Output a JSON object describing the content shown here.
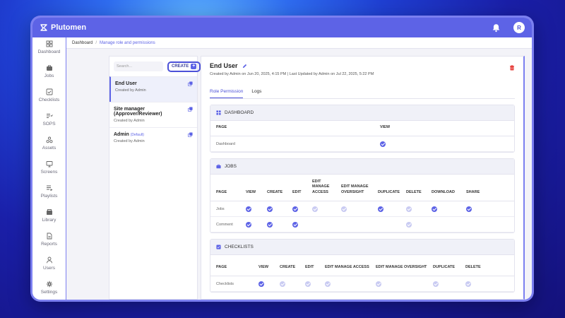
{
  "app": {
    "name": "Plutomen",
    "user_initial": "R"
  },
  "sidebar": {
    "items": [
      {
        "label": "Dashboard",
        "icon": "grid-icon"
      },
      {
        "label": "Jobs",
        "icon": "briefcase-icon"
      },
      {
        "label": "Checklists",
        "icon": "checklist-icon"
      },
      {
        "label": "SOPS",
        "icon": "list-icon"
      },
      {
        "label": "Assets",
        "icon": "assets-icon"
      },
      {
        "label": "Screens",
        "icon": "monitor-icon"
      },
      {
        "label": "Playlists",
        "icon": "playlist-icon"
      },
      {
        "label": "Library",
        "icon": "library-icon"
      },
      {
        "label": "Reports",
        "icon": "report-icon"
      },
      {
        "label": "Users",
        "icon": "user-icon"
      },
      {
        "label": "Settings",
        "icon": "gear-icon"
      }
    ]
  },
  "breadcrumb": {
    "root": "Dashboard",
    "current": "Manage role and permissions"
  },
  "roles_panel": {
    "search_placeholder": "Search...",
    "create_label": "CREATE",
    "roles": [
      {
        "name": "End User",
        "tag": "",
        "created_by": "Created by Admin",
        "active": true
      },
      {
        "name": "Site manager (Approver/Reviewer)",
        "tag": "",
        "created_by": "Created by Admin",
        "active": false
      },
      {
        "name": "Admin",
        "tag": "(Default)",
        "created_by": "Created by Admin",
        "active": false
      }
    ]
  },
  "detail": {
    "title": "End User",
    "meta": "Created by Admin on Jun 20, 2025, 4:15 PM | Last Updated by Admin on Jul 22, 2025, 5:22 PM",
    "tabs": [
      {
        "label": "Role Permission",
        "active": true
      },
      {
        "label": "Logs",
        "active": false
      }
    ],
    "sections": {
      "dashboard": {
        "title": "DASHBOARD",
        "headers": [
          "PAGE",
          "VIEW"
        ],
        "rows": [
          {
            "page": "Dashboard",
            "cells": [
              "on"
            ]
          }
        ]
      },
      "jobs": {
        "title": "JOBS",
        "headers": [
          "PAGE",
          "VIEW",
          "CREATE",
          "EDIT",
          "EDIT MANAGE ACCESS",
          "EDIT MANAGE OVERSIGHT",
          "DUPLICATE",
          "DELETE",
          "DOWNLOAD",
          "SHARE"
        ],
        "rows": [
          {
            "page": "Jobs",
            "cells": [
              "on",
              "on",
              "on",
              "off",
              "off",
              "on",
              "off",
              "on",
              "on"
            ]
          },
          {
            "page": "Comment",
            "cells": [
              "on",
              "on",
              "on",
              "",
              "",
              "",
              "off",
              "",
              ""
            ]
          }
        ]
      },
      "checklists": {
        "title": "CHECKLISTS",
        "headers": [
          "PAGE",
          "VIEW",
          "CREATE",
          "EDIT",
          "EDIT MANAGE ACCESS",
          "EDIT MANAGE OVERSIGHT",
          "DUPLICATE",
          "DELETE"
        ],
        "rows": [
          {
            "page": "Checklists",
            "cells": [
              "on",
              "off",
              "off",
              "off",
              "off",
              "off",
              "off"
            ]
          }
        ]
      }
    }
  },
  "colors": {
    "accent": "#5d63e6",
    "accent_light": "#c9cbf2",
    "frame": "#7b7ff0"
  }
}
